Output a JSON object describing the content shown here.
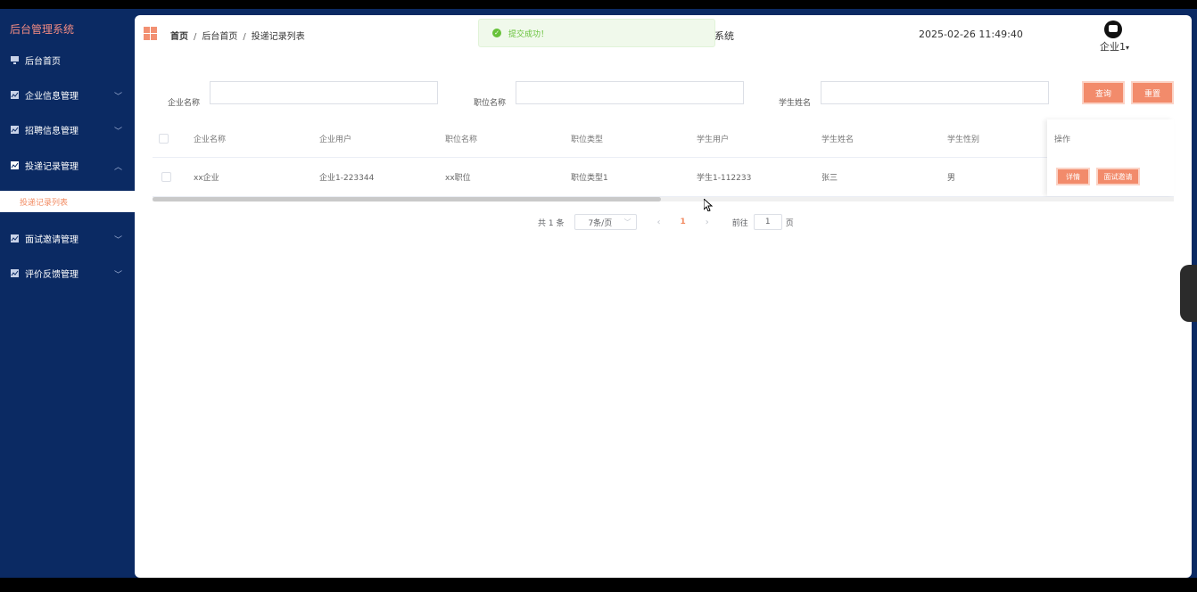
{
  "sidebar": {
    "brand": "后台管理系统",
    "items": [
      {
        "label": "后台首页"
      },
      {
        "label": "企业信息管理"
      },
      {
        "label": "招聘信息管理"
      },
      {
        "label": "投递记录管理"
      },
      {
        "label": "面试邀请管理"
      },
      {
        "label": "评价反馈管理"
      }
    ],
    "submenu_active": "投递记录列表"
  },
  "header": {
    "breadcrumb": [
      "首页",
      "后台首页",
      "投递记录列表"
    ],
    "system_title_fragment": "系统",
    "datetime": "2025-02-26 11:49:40",
    "user_name": "企业1"
  },
  "toast": {
    "message": "提交成功！",
    "color": "#67c23a"
  },
  "filters": {
    "company_label": "企业名称",
    "position_label": "职位名称",
    "student_label": "学生姓名",
    "company_value": "",
    "position_value": "",
    "student_value": "",
    "query_btn": "查询",
    "reset_btn": "重置"
  },
  "table": {
    "columns": [
      "企业名称",
      "企业用户",
      "职位名称",
      "职位类型",
      "学生用户",
      "学生姓名",
      "学生性别",
      "操作"
    ],
    "rows": [
      {
        "company": "xx企业",
        "company_user": "企业1-223344",
        "position": "xx职位",
        "position_type": "职位类型1",
        "student_user": "学生1-112233",
        "student_name": "张三",
        "gender": "男",
        "detail_btn": "详情",
        "invite_btn": "面试邀请"
      }
    ]
  },
  "pagination": {
    "total": "共 1 条",
    "page_size": "7条/页",
    "current_page": "1",
    "goto_label": "前往",
    "goto_value": "1",
    "goto_suffix": "页"
  },
  "colors": {
    "sidebar_bg": "#0b2a63",
    "accent": "#f28b6b",
    "brand_text": "#f28b82"
  }
}
